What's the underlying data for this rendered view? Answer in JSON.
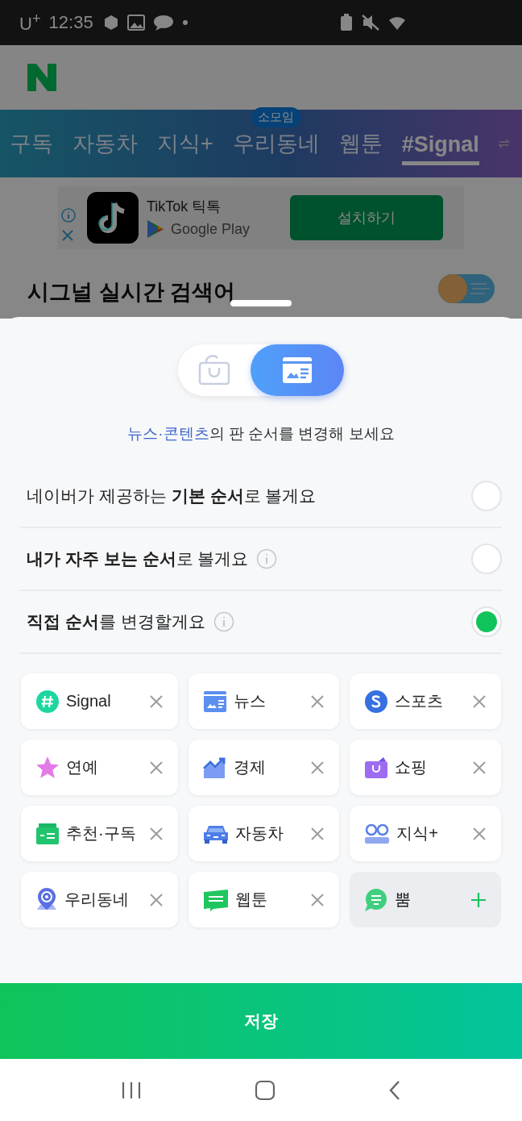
{
  "status_bar": {
    "carrier": "U$^{+}$",
    "time": "12:35"
  },
  "background": {
    "tabs": [
      {
        "label": "구독",
        "selected": false
      },
      {
        "label": "자동차",
        "selected": false
      },
      {
        "label": "지식+",
        "selected": false
      },
      {
        "label": "우리동네",
        "selected": false,
        "badge": "소모임"
      },
      {
        "label": "웹툰",
        "selected": false
      },
      {
        "label": "#Signal",
        "selected": true
      }
    ],
    "ad": {
      "app_name": "TikTok 틱톡",
      "store": "Google Play",
      "button": "설치하기"
    },
    "heading": "시그널 실시간 검색어"
  },
  "sheet": {
    "segments": [
      {
        "selected": false
      },
      {
        "selected": true
      }
    ],
    "subtitle": {
      "highlight": "뉴스·콘텐츠",
      "text": "의 판 순서를 변경해 보세요"
    },
    "options": [
      {
        "label": "네이버가 제공하는 **기본 순서**로 볼게요",
        "info": false,
        "selected": false
      },
      {
        "label": "**내가 자주 보는 순서**로 볼게요",
        "info": true,
        "selected": false
      },
      {
        "label": "**직접 순서**를 변경할게요",
        "info": true,
        "selected": true
      }
    ],
    "chips": [
      {
        "label": "Signal",
        "added": true
      },
      {
        "label": "뉴스",
        "added": true
      },
      {
        "label": "스포츠",
        "added": true
      },
      {
        "label": "연예",
        "added": true
      },
      {
        "label": "경제",
        "added": true
      },
      {
        "label": "쇼핑",
        "added": true
      },
      {
        "label": "추천·구독",
        "added": true
      },
      {
        "label": "자동차",
        "added": true
      },
      {
        "label": "지식+",
        "added": true
      },
      {
        "label": "우리동네",
        "added": true
      },
      {
        "label": "웹툰",
        "added": true
      },
      {
        "label": "뿜",
        "added": false
      }
    ],
    "save_button": "저장"
  }
}
